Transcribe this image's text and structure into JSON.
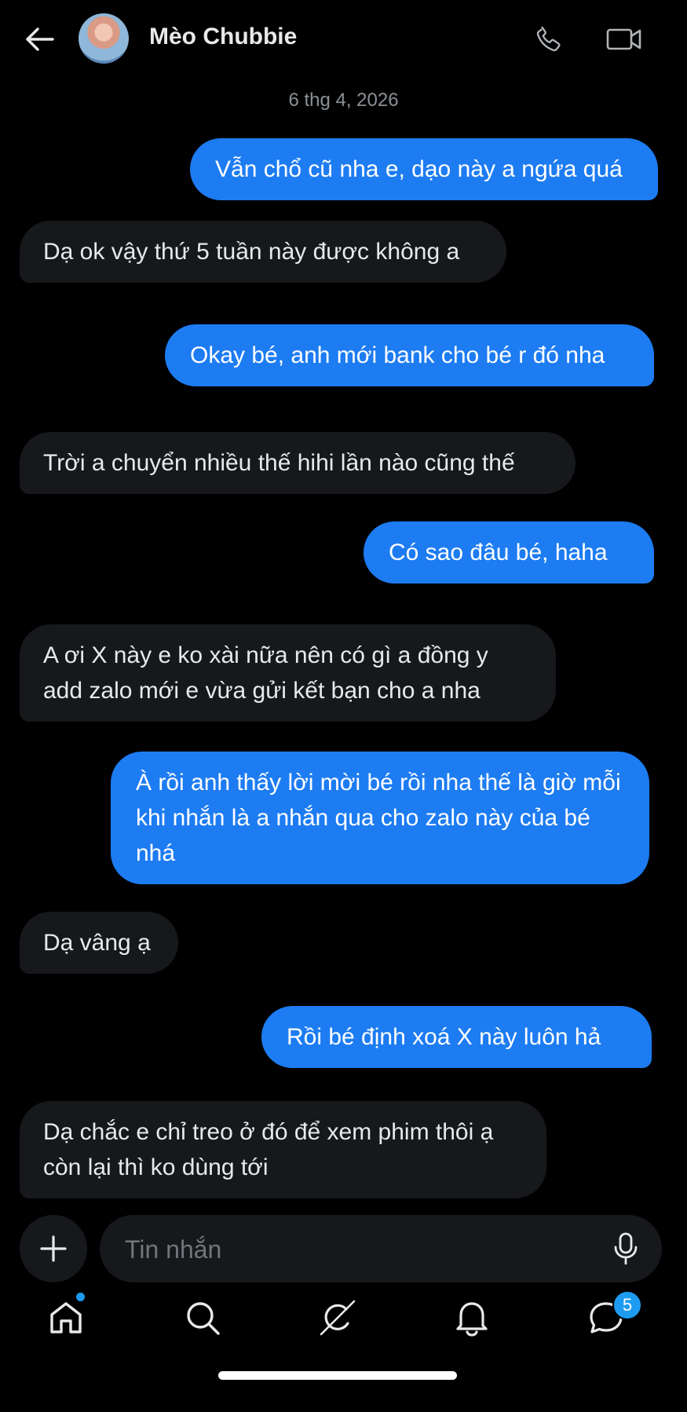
{
  "header": {
    "contact_name": "Mèo Chubbie"
  },
  "date_divider": "6 thg 4, 2026",
  "messages": [
    {
      "from": "me",
      "text": "Vẫn chổ cũ nha e, dạo này a ngứa quá"
    },
    {
      "from": "them",
      "text": "Dạ ok vậy thứ 5 tuần này được không a"
    },
    {
      "from": "me",
      "text": "Okay bé, anh mới bank cho bé r đó nha"
    },
    {
      "from": "them",
      "text": "Trời a chuyển nhiều thế hihi lần nào cũng thế"
    },
    {
      "from": "me",
      "text": "Có sao đâu bé, haha"
    },
    {
      "from": "them",
      "text": "A ơi X này e ko xài nữa nên có gì a đồng y add zalo mới e vừa gửi kết bạn cho a nha"
    },
    {
      "from": "me",
      "text": "À rồi anh thấy lời mời bé rồi nha thế là giờ mỗi khi nhắn là a nhắn qua cho zalo này của bé nhá"
    },
    {
      "from": "them",
      "text": "Dạ vâng ạ"
    },
    {
      "from": "me",
      "text": "Rồi bé định xoá X này luôn hả"
    },
    {
      "from": "them",
      "text": "Dạ chắc e chỉ treo ở đó để xem phim thôi ạ còn lại thì ko dùng tới"
    }
  ],
  "composer": {
    "placeholder": "Tin nhắn"
  },
  "nav": {
    "items": [
      "home-icon",
      "search-icon",
      "grok-icon",
      "bell-icon",
      "messages-icon"
    ],
    "messages_badge": "5"
  },
  "colors": {
    "sent_bubble": "#1d7cf2",
    "received_bubble": "#16181b",
    "accent": "#1d9bf0"
  }
}
